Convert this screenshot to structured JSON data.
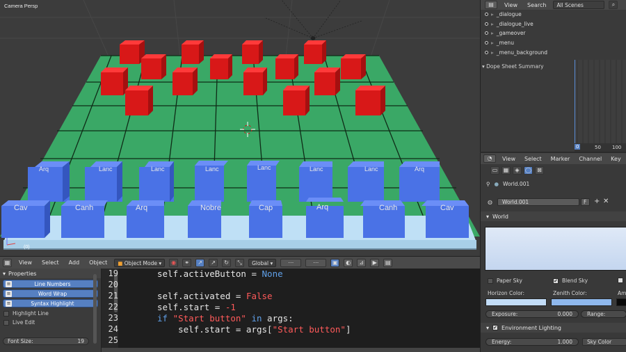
{
  "viewport": {
    "camera_label": "Camera Persp",
    "frame_label": "(0)",
    "pieces_back_row": [
      "Arq",
      "Lanc",
      "Lanc",
      "Lanc",
      "Lanc",
      "Lanc",
      "Lanc",
      "Arq"
    ],
    "pieces_front_row": [
      "Cav",
      "Canh",
      "Arq",
      "Nobre",
      "Cap",
      "Arq",
      "Canh",
      "Cav"
    ],
    "colors": {
      "board": "#3aa866",
      "enemy": "#dc1c1c",
      "player": "#4a72e6",
      "rail": "#bfe0f6"
    }
  },
  "viewport_header": {
    "menus": [
      "View",
      "Select",
      "Add",
      "Object"
    ],
    "mode": "Object Mode",
    "pivot": "Global"
  },
  "text_props": {
    "title": "Properties",
    "toggles": [
      "Line Numbers",
      "Word Wrap",
      "Syntax Highlight"
    ],
    "checks": [
      "Highlight Line",
      "Live Edit"
    ],
    "font_size_label": "Font Size:",
    "font_size_value": "19"
  },
  "code": {
    "lines": [
      {
        "no": "19",
        "parts": [
          {
            "t": "self.activeButton = "
          },
          {
            "t": "None",
            "c": "kw"
          }
        ]
      },
      {
        "no": "20",
        "parts": []
      },
      {
        "no": "21",
        "parts": [
          {
            "t": "self.activated = "
          },
          {
            "t": "False",
            "c": "str"
          }
        ]
      },
      {
        "no": "22",
        "parts": [
          {
            "t": "self.start = "
          },
          {
            "t": "-1",
            "c": "str"
          }
        ]
      },
      {
        "no": "23",
        "parts": [
          {
            "t": "if ",
            "c": "kw"
          },
          {
            "t": "\"Start button\"",
            "c": "str"
          },
          {
            "t": " in ",
            "c": "kw"
          },
          {
            "t": "args:"
          }
        ]
      },
      {
        "no": "24",
        "parts": [
          {
            "t": "    self.start = args["
          },
          {
            "t": "\"Start button\"",
            "c": "str"
          },
          {
            "t": "]"
          }
        ]
      },
      {
        "no": "25",
        "parts": []
      }
    ]
  },
  "outliner": {
    "menus": [
      "View",
      "Search"
    ],
    "filter": "All Scenes",
    "items": [
      "_dialogue",
      "_dialogue_live",
      "_gameover",
      "_menu",
      "_menu_background"
    ]
  },
  "dope": {
    "summary": "Dope Sheet Summary",
    "frame_current": "0",
    "ticks": [
      "50",
      "100"
    ]
  },
  "timeline_header": {
    "menus": [
      "View",
      "Select",
      "Marker",
      "Channel",
      "Key"
    ]
  },
  "world": {
    "name": "World.001",
    "datablock": "World.001",
    "fake_user": "F",
    "panel_world": "World",
    "paper_sky": "Paper Sky",
    "blend_sky": "Blend Sky",
    "horizon_label": "Horizon Color:",
    "zenith_label": "Zenith Color:",
    "ambient_label": "Am",
    "exposure_label": "Exposure:",
    "exposure_value": "0.000",
    "range_label": "Range:",
    "env_lighting": "Environment Lighting",
    "energy_label": "Energy:",
    "energy_value": "1.000",
    "sky_color": "Sky Color",
    "colors": {
      "horizon": "#c2dcf7",
      "zenith": "#8fb8ec",
      "ambient": "#0a0a0a"
    }
  }
}
